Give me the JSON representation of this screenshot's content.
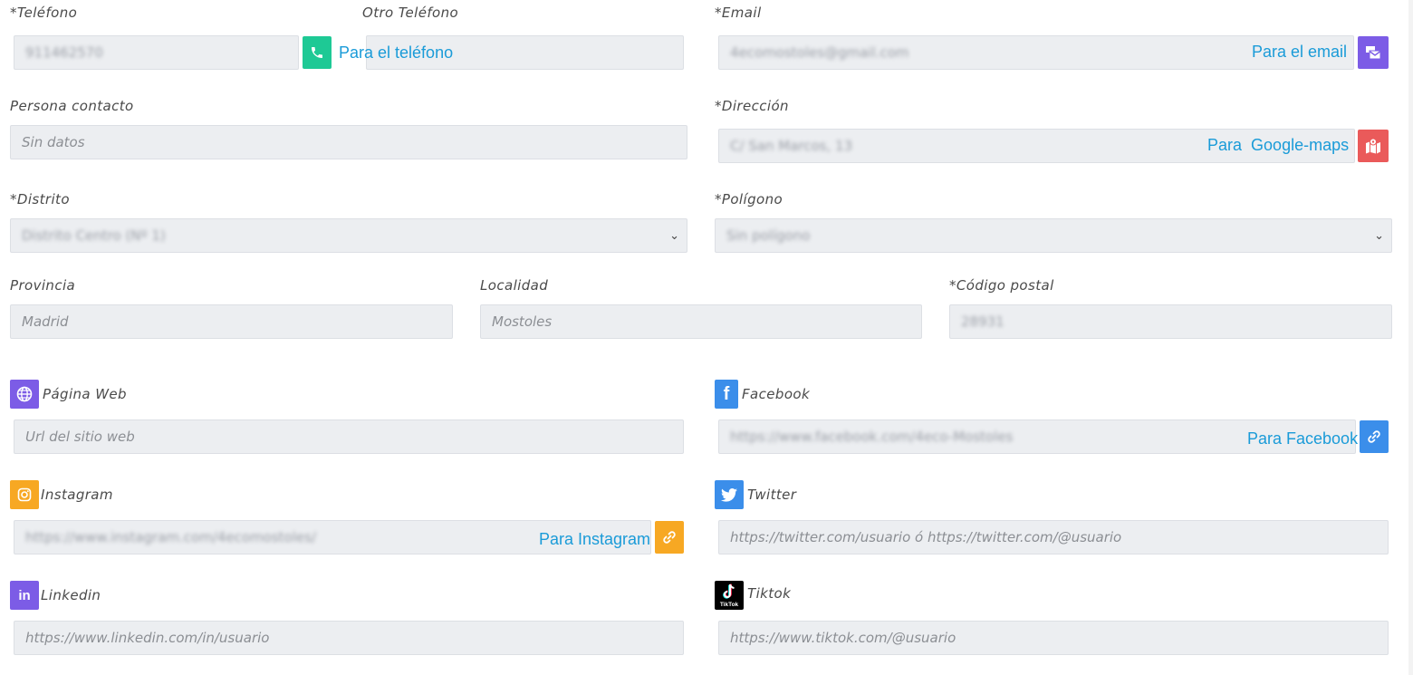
{
  "telefono": {
    "label": "Teléfono",
    "required_mark": "*",
    "value": "911462570",
    "link": "Para el teléfono"
  },
  "otro_telefono": {
    "label": "Otro Teléfono",
    "value": ""
  },
  "email": {
    "label": "Email",
    "required_mark": "*",
    "value": "4ecomostoles@gmail.com",
    "link": "Para el email"
  },
  "persona_contacto": {
    "label": "Persona contacto",
    "placeholder": "Sin datos"
  },
  "direccion": {
    "label": "Dirección",
    "required_mark": "*",
    "value": "C/ San Marcos, 13",
    "link_part1": "Para",
    "link_part2": "Google-maps"
  },
  "distrito": {
    "label": "Distrito",
    "required_mark": "*",
    "value": "Distrito Centro (Nº 1)"
  },
  "poligono": {
    "label": "Polígono",
    "required_mark": "*",
    "value": "Sin polígono"
  },
  "provincia": {
    "label": "Provincia",
    "value": "Madrid"
  },
  "localidad": {
    "label": "Localidad",
    "value": "Mostoles"
  },
  "codigo_postal": {
    "label": "Código postal",
    "required_mark": "*",
    "value": "28931"
  },
  "pagina_web": {
    "label": "Página Web",
    "placeholder": "Url del sitio web"
  },
  "facebook": {
    "label": "Facebook",
    "value": "https://www.facebook.com/4eco-Mostoles",
    "link": "Para Facebook"
  },
  "instagram": {
    "label": "Instagram",
    "value": "https://www.instagram.com/4ecomostoles/",
    "link": "Para Instagram"
  },
  "twitter": {
    "label": "Twitter",
    "placeholder": "https://twitter.com/usuario ó https://twitter.com/@usuario"
  },
  "linkedin": {
    "label": "Linkedin",
    "placeholder": "https://www.linkedin.com/in/usuario"
  },
  "tiktok": {
    "label": "Tiktok",
    "placeholder": "https://www.tiktok.com/@usuario",
    "logo_text": "TikTok"
  },
  "colors": {
    "green": "#1ec995",
    "purple": "#7c5ce6",
    "red": "#ea5a5a",
    "orange": "#f7a823",
    "blue": "#3b8eea",
    "link": "#1a9bd8",
    "field_bg": "#eceef1"
  }
}
